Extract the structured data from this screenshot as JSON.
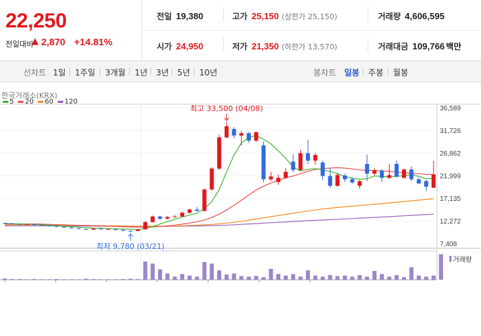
{
  "summary": {
    "price": "22,250",
    "change_label": "전일대비",
    "change_arrow": "▲",
    "change_value": "2,870",
    "change_pct": "+14.81%"
  },
  "stats": {
    "prev_label": "전일",
    "prev_value": "19,380",
    "open_label": "시가",
    "open_value": "24,950",
    "high_label": "고가",
    "high_value": "25,150",
    "upper_limit": "(상한가 25,150)",
    "low_label": "저가",
    "low_value": "21,350",
    "lower_limit": "(하한가 13,570)",
    "volume_label": "거래량",
    "volume_value": "4,606,595",
    "amount_label": "거래대금",
    "amount_value": "109,766",
    "amount_unit": "백만"
  },
  "tabs": {
    "line_title": "선차트",
    "line_tabs": [
      "1일",
      "1주일",
      "3개월",
      "1년",
      "3년",
      "5년",
      "10년"
    ],
    "candle_title": "봉차트",
    "candle_tabs": [
      "일봉",
      "주봉",
      "월봉"
    ],
    "active_candle": "일봉"
  },
  "exchange": "한국거래소(KRX)",
  "legend": [
    {
      "label": "5",
      "color": "#3cb531"
    },
    {
      "label": "20",
      "color": "#e8504c"
    },
    {
      "label": "60",
      "color": "#f28c20"
    },
    {
      "label": "120",
      "color": "#9a62c2"
    }
  ],
  "colors": {
    "up": "#e0191f",
    "down": "#2f6bdd",
    "volume": "#9b86c6"
  },
  "chart_data": {
    "type": "candlestick",
    "y_ticks": [
      "36,589",
      "31,726",
      "26,862",
      "21,999",
      "17,135",
      "12,272",
      "7,408"
    ],
    "ylim": [
      7408,
      36589
    ],
    "annotations": {
      "high": "최고 33,500 (04/08)",
      "low": "최저 9,780 (03/21)"
    },
    "volume_label": "거래량",
    "candles": [
      [
        11820,
        11900,
        11650,
        11720
      ],
      [
        11720,
        11800,
        11550,
        11600
      ],
      [
        11600,
        11700,
        11450,
        11520
      ],
      [
        11520,
        11650,
        11400,
        11560
      ],
      [
        11560,
        11600,
        11300,
        11380
      ],
      [
        11380,
        11450,
        11200,
        11260
      ],
      [
        11260,
        11350,
        11050,
        11120
      ],
      [
        11120,
        11200,
        10900,
        10980
      ],
      [
        10980,
        11050,
        10750,
        10820
      ],
      [
        10820,
        10900,
        10600,
        10680
      ],
      [
        10680,
        10750,
        10450,
        10520
      ],
      [
        10520,
        10600,
        10300,
        10380
      ],
      [
        10380,
        10700,
        10300,
        10620
      ],
      [
        10620,
        10680,
        10380,
        10440
      ],
      [
        10440,
        10600,
        10350,
        10520
      ],
      [
        10520,
        10580,
        10250,
        10300
      ],
      [
        10300,
        10400,
        10050,
        10120
      ],
      [
        10120,
        10250,
        9780,
        10080
      ],
      [
        10080,
        10500,
        10000,
        10420
      ],
      [
        10420,
        12200,
        10400,
        12000
      ],
      [
        12000,
        13400,
        11900,
        13200
      ],
      [
        13200,
        13300,
        12500,
        12700
      ],
      [
        12700,
        13300,
        12600,
        13100
      ],
      [
        13100,
        13500,
        12900,
        13200
      ],
      [
        13200,
        14200,
        13000,
        14000
      ],
      [
        14000,
        14900,
        13800,
        14700
      ],
      [
        14700,
        15200,
        14300,
        14400
      ],
      [
        14400,
        19200,
        14300,
        19000
      ],
      [
        19000,
        23800,
        18800,
        23500
      ],
      [
        23500,
        30800,
        23200,
        30200
      ],
      [
        30200,
        33500,
        30000,
        32600
      ],
      [
        32000,
        32400,
        30000,
        30600
      ],
      [
        30600,
        31600,
        28500,
        31100
      ],
      [
        31100,
        31400,
        29000,
        29500
      ],
      [
        29500,
        31500,
        29200,
        31300
      ],
      [
        28500,
        29300,
        20500,
        21200
      ],
      [
        21200,
        22800,
        20800,
        21800
      ],
      [
        20600,
        22200,
        20000,
        21500
      ],
      [
        21500,
        23600,
        21300,
        22800
      ],
      [
        25000,
        26600,
        22700,
        23200
      ],
      [
        23200,
        27500,
        23000,
        26800
      ],
      [
        26800,
        29700,
        24500,
        25200
      ],
      [
        25200,
        26900,
        24400,
        26400
      ],
      [
        24800,
        25200,
        21000,
        21900
      ],
      [
        21900,
        23600,
        19300,
        19800
      ],
      [
        19800,
        22600,
        19600,
        22100
      ],
      [
        22000,
        22400,
        20600,
        21200
      ],
      [
        21200,
        21600,
        20300,
        20500
      ],
      [
        19800,
        21000,
        19200,
        20800
      ],
      [
        24500,
        26500,
        20800,
        22400
      ],
      [
        22400,
        23600,
        22000,
        23100
      ],
      [
        23100,
        23400,
        20600,
        21500
      ],
      [
        21500,
        24500,
        21300,
        22100
      ],
      [
        24500,
        25200,
        21500,
        21800
      ],
      [
        21500,
        23500,
        21300,
        23300
      ],
      [
        23300,
        24000,
        20800,
        21200
      ],
      [
        21200,
        21500,
        20200,
        20300
      ],
      [
        20800,
        21100,
        18600,
        19600
      ],
      [
        19380,
        25150,
        21350,
        22250
      ]
    ],
    "ma5": [
      11700,
      11650,
      11600,
      11550,
      11500,
      11400,
      11300,
      11200,
      11100,
      11000,
      10900,
      10800,
      10700,
      10650,
      10600,
      10550,
      10500,
      10450,
      10400,
      10600,
      11000,
      11600,
      12100,
      12600,
      13100,
      13500,
      13900,
      14900,
      16400,
      19000,
      22800,
      26400,
      29000,
      30200,
      30600,
      29800,
      28800,
      27300,
      25700,
      23800,
      23000,
      23300,
      23500,
      23200,
      22900,
      22400,
      21800,
      21400,
      21200,
      21300,
      21900,
      21800,
      21700,
      21800,
      22000,
      22200,
      21800,
      21300,
      21400
    ],
    "ma20": [
      11600,
      11600,
      11600,
      11600,
      11600,
      11550,
      11500,
      11450,
      11400,
      11350,
      11300,
      11250,
      11200,
      11150,
      11100,
      11050,
      11000,
      10950,
      10900,
      10900,
      10950,
      11050,
      11200,
      11350,
      11550,
      11800,
      12050,
      12450,
      13000,
      13700,
      14600,
      15600,
      16700,
      17800,
      18900,
      19700,
      20400,
      21000,
      21500,
      21900,
      22400,
      22900,
      23300,
      23500,
      23600,
      23700,
      23600,
      23400,
      23200,
      23100,
      23100,
      23000,
      22900,
      22700,
      22600,
      22500,
      22400,
      22250,
      22200
    ],
    "ma60": [
      11400,
      11400,
      11400,
      11400,
      11400,
      11380,
      11360,
      11340,
      11320,
      11300,
      11280,
      11260,
      11240,
      11220,
      11200,
      11180,
      11160,
      11140,
      11120,
      11110,
      11110,
      11120,
      11140,
      11170,
      11210,
      11260,
      11320,
      11400,
      11500,
      11630,
      11780,
      11960,
      12170,
      12400,
      12650,
      12900,
      13150,
      13400,
      13650,
      13900,
      14150,
      14380,
      14600,
      14800,
      14980,
      15140,
      15290,
      15430,
      15560,
      15690,
      15830,
      15970,
      16110,
      16260,
      16410,
      16560,
      16710,
      16860,
      17000
    ],
    "ma120": [
      11200,
      11200,
      11200,
      11200,
      11200,
      11190,
      11180,
      11170,
      11160,
      11150,
      11140,
      11130,
      11120,
      11110,
      11100,
      11090,
      11080,
      11070,
      11060,
      11060,
      11060,
      11070,
      11080,
      11100,
      11120,
      11140,
      11170,
      11200,
      11240,
      11290,
      11350,
      11420,
      11500,
      11590,
      11680,
      11770,
      11860,
      11950,
      12040,
      12120,
      12200,
      12280,
      12360,
      12440,
      12520,
      12600,
      12680,
      12760,
      12840,
      12920,
      13000,
      13080,
      13160,
      13250,
      13340,
      13430,
      13520,
      13610,
      13700
    ],
    "volumes": [
      5,
      3,
      3,
      2,
      3,
      2,
      2,
      3,
      2,
      2,
      2,
      4,
      3,
      2,
      2,
      2,
      3,
      4,
      3,
      70,
      62,
      40,
      24,
      12,
      22,
      16,
      12,
      68,
      62,
      36,
      20,
      24,
      14,
      12,
      15,
      10,
      42,
      22,
      16,
      22,
      12,
      36,
      16,
      12,
      18,
      14,
      16,
      12,
      18,
      12,
      34,
      22,
      12,
      18,
      10,
      48,
      16,
      12,
      16,
      98
    ]
  }
}
